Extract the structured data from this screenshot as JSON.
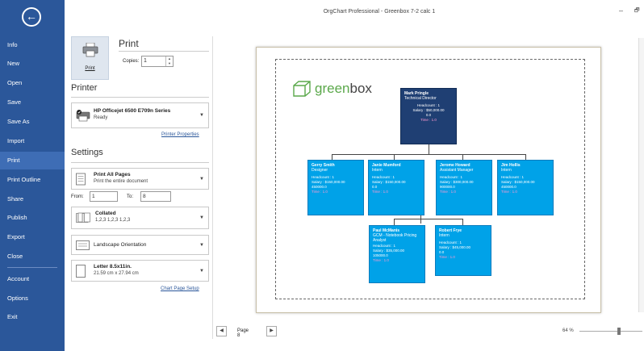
{
  "window": {
    "title": "OrgChart Professional - Greenbox 7-2 calc 1",
    "minimize": "–",
    "restore": "🗗"
  },
  "nav": {
    "back_icon": "arrow-left-circle-icon",
    "items": [
      "Info",
      "New",
      "Open",
      "Save",
      "Save As",
      "Import",
      "Print",
      "Print Outline",
      "Share",
      "Publish",
      "Export",
      "Close",
      "Account",
      "Options",
      "Exit"
    ],
    "active": "Print"
  },
  "print": {
    "heading": "Print",
    "button_label": "Print",
    "copies_label": "Copies:",
    "copies_value": "1"
  },
  "printer": {
    "heading": "Printer",
    "name": "HP Officejet 6500 E709n Series",
    "status": "Ready",
    "properties_link": "Printer Properties"
  },
  "settings": {
    "heading": "Settings",
    "pages": {
      "main": "Print All Pages",
      "sub": "Print the entire document"
    },
    "from_label": "From:",
    "from_value": "1",
    "to_label": "To:",
    "to_value": "8",
    "collate": {
      "main": "Collated",
      "sub": "1,2,3   1,2,3   1,2,3"
    },
    "orientation": {
      "main": "Landscape Orientation"
    },
    "paper": {
      "main": "Letter 8.5x11in.",
      "sub": "21.59 cm x 27.94 cm"
    },
    "setup_link": "Chart Page Setup"
  },
  "preview": {
    "logo_text_green": "green",
    "logo_text_dark": "box",
    "nodes": {
      "top": {
        "name": "Mark Pringle",
        "title": "Technical Director",
        "headcount": "Headcount : 1",
        "salary": "Salary : $50,000.00",
        "salary2": "0.0",
        "time": "Time : 1.0"
      },
      "gerry": {
        "name": "Gerry Smith",
        "title": "Designer",
        "headcount": "Headcount : 1",
        "salary": "Salary : $150,000.00",
        "salary2": "450000.0",
        "time": "Time : 1.0"
      },
      "janie": {
        "name": "Janie Mumford",
        "title": "Intern",
        "headcount": "Headcount : 1",
        "salary": "Salary : $150,000.00",
        "salary2": "0.0",
        "time": "Time : 1.0"
      },
      "jerome": {
        "name": "Jerome Howard",
        "title": "Assistant Manager",
        "headcount": "Headcount : 1",
        "salary": "Salary : $300,000.00",
        "salary2": "900000.0",
        "time": "Time : 1.0"
      },
      "jim": {
        "name": "Jim Hollis",
        "title": "Intern",
        "headcount": "Headcount : 1",
        "salary": "Salary : $150,000.00",
        "salary2": "450000.0",
        "time": "Time : 1.0"
      },
      "paul": {
        "name": "Paul McManis",
        "title": "GCM - Notebook Pricing Analyst",
        "headcount": "Headcount : 1",
        "salary": "Salary : $35,000.00",
        "salary2": "105000.0",
        "time": "Time : 1.0"
      },
      "robert": {
        "name": "Robert Frye",
        "title": "Intern",
        "headcount": "Headcount : 1",
        "salary": "Salary : $45,000.00",
        "salary2": "0.0",
        "time": "Time : 1.0"
      }
    }
  },
  "pager": {
    "prev_icon": "◀",
    "next_icon": "▶",
    "label": "Page 8"
  },
  "zoom": {
    "label": "64 %"
  }
}
